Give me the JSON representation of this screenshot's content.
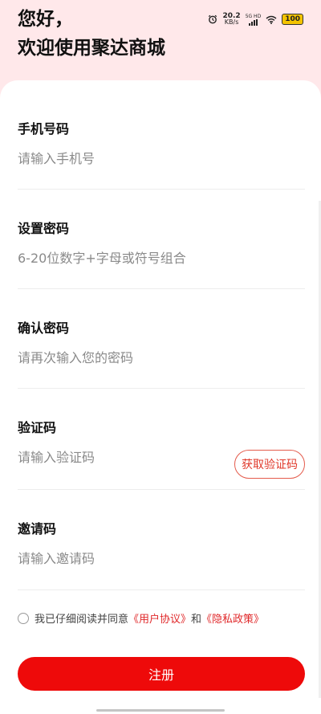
{
  "status_bar": {
    "net_speed_value": "20.2",
    "net_speed_unit": "KB/s",
    "network_type": "5G HD",
    "battery": "100"
  },
  "greeting": {
    "line1": "您好，",
    "line2": "欢迎使用聚达商城"
  },
  "form": {
    "phone": {
      "label": "手机号码",
      "placeholder": "请输入手机号"
    },
    "password": {
      "label": "设置密码",
      "placeholder": "6-20位数字+字母或符号组合"
    },
    "confirm_password": {
      "label": "确认密码",
      "placeholder": "请再次输入您的密码"
    },
    "verify_code": {
      "label": "验证码",
      "placeholder": "请输入验证码",
      "button": "获取验证码"
    },
    "invite_code": {
      "label": "邀请码",
      "placeholder": "请输入邀请码"
    }
  },
  "agreement": {
    "prefix": "我已仔细阅读并同意",
    "user_agreement": "《用户协议》",
    "and": "和",
    "privacy_policy": "《隐私政策》"
  },
  "register_button": "注册",
  "colors": {
    "accent": "#ee0a0a",
    "header_bg": "#ffe8ea",
    "link": "#e0282a"
  }
}
